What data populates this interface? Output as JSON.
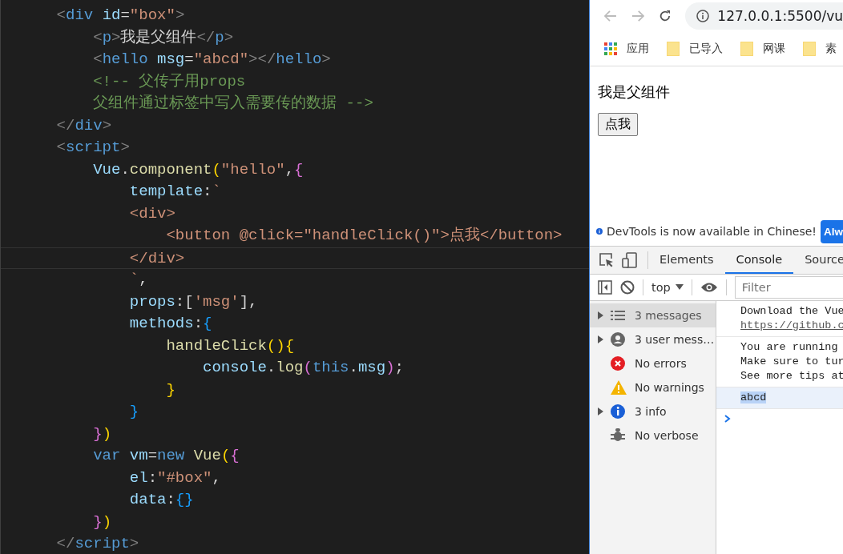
{
  "editor": {
    "lines": [
      {
        "tokens": [
          {
            "text": "    <",
            "kind": "punct"
          },
          {
            "text": "div",
            "kind": "tag"
          },
          {
            "text": " id",
            "kind": "attr"
          },
          {
            "text": "=",
            "kind": "text"
          },
          {
            "text": "\"box\"",
            "kind": "str"
          },
          {
            "text": ">",
            "kind": "punct"
          }
        ]
      },
      {
        "tokens": [
          {
            "text": "        <",
            "kind": "punct"
          },
          {
            "text": "p",
            "kind": "tag"
          },
          {
            "text": ">",
            "kind": "punct"
          },
          {
            "text": "我是父组件",
            "kind": "text"
          },
          {
            "text": "</",
            "kind": "punct"
          },
          {
            "text": "p",
            "kind": "tag"
          },
          {
            "text": ">",
            "kind": "punct"
          }
        ]
      },
      {
        "tokens": [
          {
            "text": "        <",
            "kind": "punct"
          },
          {
            "text": "hello",
            "kind": "tag"
          },
          {
            "text": " msg",
            "kind": "attr"
          },
          {
            "text": "=",
            "kind": "text"
          },
          {
            "text": "\"abcd\"",
            "kind": "str"
          },
          {
            "text": "></",
            "kind": "punct"
          },
          {
            "text": "hello",
            "kind": "tag"
          },
          {
            "text": ">",
            "kind": "punct"
          }
        ]
      },
      {
        "tokens": [
          {
            "text": "        <!-- 父传子用props",
            "kind": "comment"
          }
        ]
      },
      {
        "tokens": [
          {
            "text": "        父组件通过标签中写入需要传的数据 -->",
            "kind": "comment"
          }
        ]
      },
      {
        "tokens": [
          {
            "text": "    </",
            "kind": "punct"
          },
          {
            "text": "div",
            "kind": "tag"
          },
          {
            "text": ">",
            "kind": "punct"
          }
        ]
      },
      {
        "tokens": [
          {
            "text": "    <",
            "kind": "punct"
          },
          {
            "text": "script",
            "kind": "tag"
          },
          {
            "text": ">",
            "kind": "punct"
          }
        ]
      },
      {
        "tokens": [
          {
            "text": "        Vue",
            "kind": "var"
          },
          {
            "text": ".",
            "kind": "text"
          },
          {
            "text": "component",
            "kind": "fn"
          },
          {
            "text": "(",
            "kind": "b1"
          },
          {
            "text": "\"hello\"",
            "kind": "str"
          },
          {
            "text": ",",
            "kind": "text"
          },
          {
            "text": "{",
            "kind": "b2"
          }
        ]
      },
      {
        "tokens": [
          {
            "text": "            template",
            "kind": "var"
          },
          {
            "text": ":",
            "kind": "text"
          },
          {
            "text": "`",
            "kind": "str"
          }
        ]
      },
      {
        "tokens": [
          {
            "text": "            <div>",
            "kind": "str"
          }
        ]
      },
      {
        "tokens": [
          {
            "text": "                <button @click=\"handleClick()\">点我</button>",
            "kind": "str"
          }
        ]
      },
      {
        "tokens": [
          {
            "text": "            </div>",
            "kind": "str"
          }
        ],
        "current": true
      },
      {
        "tokens": [
          {
            "text": "            `",
            "kind": "str"
          },
          {
            "text": ",",
            "kind": "text"
          }
        ]
      },
      {
        "tokens": [
          {
            "text": "            props",
            "kind": "var"
          },
          {
            "text": ":[",
            "kind": "text"
          },
          {
            "text": "'msg'",
            "kind": "str"
          },
          {
            "text": "],",
            "kind": "text"
          }
        ]
      },
      {
        "tokens": [
          {
            "text": "            methods",
            "kind": "var"
          },
          {
            "text": ":",
            "kind": "text"
          },
          {
            "text": "{",
            "kind": "b3"
          }
        ]
      },
      {
        "tokens": [
          {
            "text": "                handleClick",
            "kind": "fn"
          },
          {
            "text": "(){",
            "kind": "b1"
          }
        ]
      },
      {
        "tokens": [
          {
            "text": "                    console",
            "kind": "var"
          },
          {
            "text": ".",
            "kind": "text"
          },
          {
            "text": "log",
            "kind": "fn"
          },
          {
            "text": "(",
            "kind": "b2"
          },
          {
            "text": "this",
            "kind": "kw"
          },
          {
            "text": ".",
            "kind": "text"
          },
          {
            "text": "msg",
            "kind": "var"
          },
          {
            "text": ")",
            "kind": "b2"
          },
          {
            "text": ";",
            "kind": "text"
          }
        ]
      },
      {
        "tokens": [
          {
            "text": "                }",
            "kind": "b1"
          }
        ]
      },
      {
        "tokens": [
          {
            "text": "            }",
            "kind": "b3"
          }
        ]
      },
      {
        "tokens": [
          {
            "text": "        }",
            "kind": "b2"
          },
          {
            "text": ")",
            "kind": "b1"
          }
        ]
      },
      {
        "tokens": [
          {
            "text": "        var",
            "kind": "kw"
          },
          {
            "text": " vm",
            "kind": "var"
          },
          {
            "text": "=",
            "kind": "text"
          },
          {
            "text": "new",
            "kind": "kw"
          },
          {
            "text": " Vue",
            "kind": "fn"
          },
          {
            "text": "(",
            "kind": "b1"
          },
          {
            "text": "{",
            "kind": "b2"
          }
        ]
      },
      {
        "tokens": [
          {
            "text": "            el",
            "kind": "var"
          },
          {
            "text": ":",
            "kind": "text"
          },
          {
            "text": "\"#box\"",
            "kind": "str"
          },
          {
            "text": ",",
            "kind": "text"
          }
        ]
      },
      {
        "tokens": [
          {
            "text": "            data",
            "kind": "var"
          },
          {
            "text": ":",
            "kind": "text"
          },
          {
            "text": "{}",
            "kind": "b3"
          }
        ]
      },
      {
        "tokens": [
          {
            "text": "        }",
            "kind": "b2"
          },
          {
            "text": ")",
            "kind": "b1"
          }
        ]
      },
      {
        "tokens": [
          {
            "text": "    </",
            "kind": "punct"
          },
          {
            "text": "script",
            "kind": "tag"
          },
          {
            "text": ">",
            "kind": "punct"
          }
        ]
      }
    ]
  },
  "browser": {
    "url": "127.0.0.1:5500/vu",
    "bookmarks": [
      {
        "label": "应用",
        "kind": "apps"
      },
      {
        "label": "已导入",
        "kind": "folder"
      },
      {
        "label": "网课",
        "kind": "folder"
      },
      {
        "label": "素",
        "kind": "folder"
      }
    ],
    "page": {
      "paragraph": "我是父组件",
      "button": "点我"
    }
  },
  "devtools": {
    "infobar": {
      "text": "DevTools is now available in Chinese!",
      "button": "Alw"
    },
    "tabs": [
      {
        "label": "Elements",
        "selected": false
      },
      {
        "label": "Console",
        "selected": true
      },
      {
        "label": "Source",
        "selected": false
      }
    ],
    "context": "top",
    "filter_placeholder": "Filter",
    "sidebar": [
      {
        "label": "3 messages",
        "kind": "list",
        "expandable": true,
        "selected": true
      },
      {
        "label": "3 user mess…",
        "kind": "user",
        "expandable": true,
        "selected": false
      },
      {
        "label": "No errors",
        "kind": "error",
        "expandable": false,
        "selected": false
      },
      {
        "label": "No warnings",
        "kind": "warning",
        "expandable": false,
        "selected": false
      },
      {
        "label": "3 info",
        "kind": "info",
        "expandable": true,
        "selected": false
      },
      {
        "label": "No verbose",
        "kind": "verbose",
        "expandable": false,
        "selected": false
      }
    ],
    "messages": [
      {
        "lines": [
          "Download the Vue"
        ],
        "link": "https://github.c",
        "selected": false
      },
      {
        "lines": [
          "You are running",
          "Make sure to tur",
          "See more tips at"
        ],
        "selected": false
      },
      {
        "lines": [
          "abcd"
        ],
        "selected": true
      }
    ]
  }
}
